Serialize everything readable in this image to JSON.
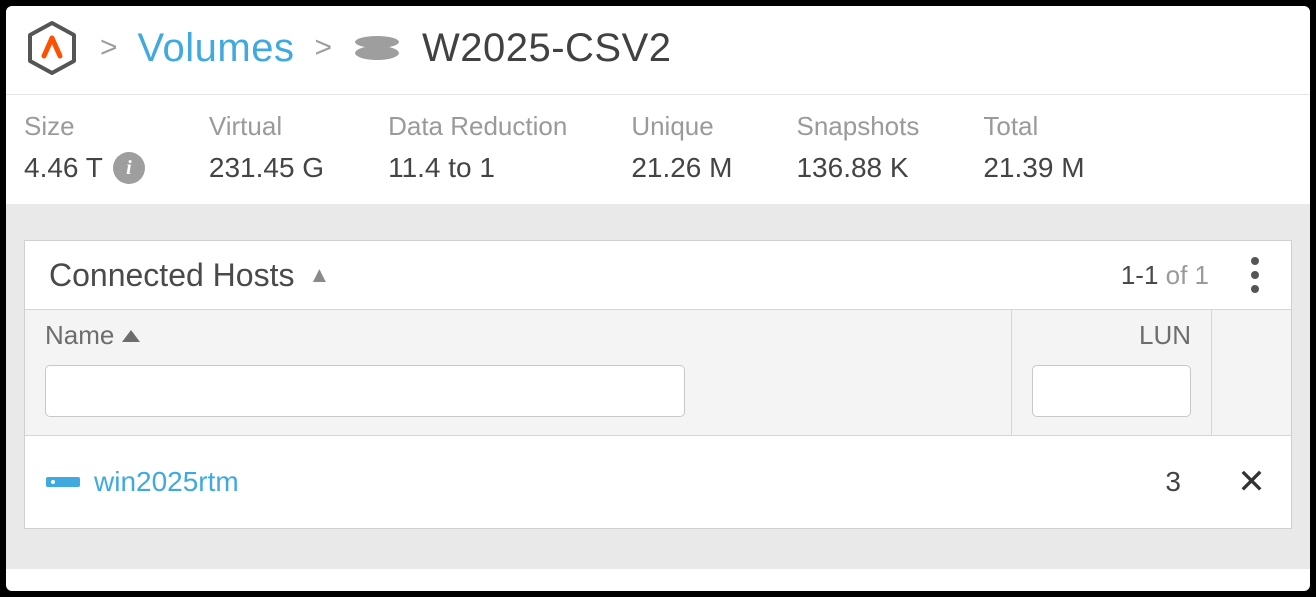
{
  "breadcrumb": {
    "volumes_label": "Volumes",
    "current": "W2025-CSV2"
  },
  "stats": {
    "size": {
      "label": "Size",
      "value": "4.46 T"
    },
    "virtual": {
      "label": "Virtual",
      "value": "231.45 G"
    },
    "data_reduction": {
      "label": "Data Reduction",
      "value": "11.4 to 1"
    },
    "unique": {
      "label": "Unique",
      "value": "21.26 M"
    },
    "snapshots": {
      "label": "Snapshots",
      "value": "136.88 K"
    },
    "total": {
      "label": "Total",
      "value": "21.39 M"
    }
  },
  "panel": {
    "title": "Connected Hosts",
    "range_strong": "1-1",
    "range_of": " of 1",
    "columns": {
      "name": "Name",
      "lun": "LUN"
    },
    "filters": {
      "name_value": "",
      "lun_value": ""
    }
  },
  "hosts": [
    {
      "name": "win2025rtm",
      "lun": "3"
    }
  ]
}
